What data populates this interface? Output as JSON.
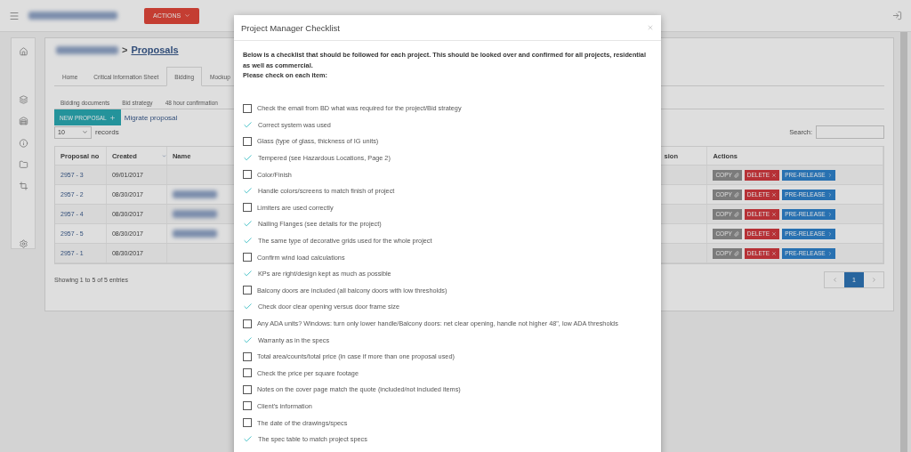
{
  "topbar": {
    "actions_button": "ACTIONS"
  },
  "breadcrumb": {
    "link": "Proposals",
    "separator": ">"
  },
  "tabs": [
    {
      "label": "Home",
      "selected": false
    },
    {
      "label": "Critical Information Sheet",
      "selected": false
    },
    {
      "label": "Bidding",
      "selected": true
    },
    {
      "label": "Mockup",
      "selected": false
    }
  ],
  "subtabs": [
    {
      "label": "Bidding documents",
      "selected": false
    },
    {
      "label": "Bid strategy",
      "selected": false
    },
    {
      "label": "48 hour confirmation",
      "selected": false
    }
  ],
  "toolbar": {
    "new_proposal": "NEW PROPOSAL",
    "migrate": "Migrate proposal",
    "page_size": "10",
    "records": "records",
    "search_label": "Search:"
  },
  "table": {
    "columns": [
      "Proposal no",
      "Created",
      "Name",
      "sion",
      "Actions"
    ],
    "rows": [
      {
        "proposal_no": "2957 - 3",
        "created": "09/01/2017",
        "has_name": false,
        "actions": [
          {
            "kind": "copy",
            "label": "COPY"
          },
          {
            "kind": "delete",
            "label": "DELETE"
          },
          {
            "kind": "release",
            "label": "PRE-RELEASE"
          }
        ]
      },
      {
        "proposal_no": "2957 - 2",
        "created": "08/30/2017",
        "has_name": true,
        "actions": [
          {
            "kind": "copy",
            "label": "COPY"
          },
          {
            "kind": "delete",
            "label": "DELETE"
          },
          {
            "kind": "release",
            "label": "PRE-RELEASE"
          }
        ]
      },
      {
        "proposal_no": "2957 - 4",
        "created": "08/30/2017",
        "has_name": true,
        "actions": [
          {
            "kind": "copy",
            "label": "COPY"
          },
          {
            "kind": "delete",
            "label": "DELETE"
          },
          {
            "kind": "release",
            "label": "PRE-RELEASE"
          }
        ]
      },
      {
        "proposal_no": "2957 - 5",
        "created": "08/30/2017",
        "has_name": true,
        "actions": [
          {
            "kind": "copy",
            "label": "COPY"
          },
          {
            "kind": "delete",
            "label": "DELETE"
          },
          {
            "kind": "release",
            "label": "PRE-RELEASE"
          }
        ]
      },
      {
        "proposal_no": "2957 - 1",
        "created": "08/30/2017",
        "has_name": false,
        "actions": [
          {
            "kind": "copy",
            "label": "COPY"
          },
          {
            "kind": "delete",
            "label": "DELETE"
          },
          {
            "kind": "release",
            "label": "PRE-RELEASE"
          }
        ]
      }
    ]
  },
  "footer": {
    "info": "Showing 1 to 5 of 5 entries",
    "pages": [
      {
        "label": "1",
        "selected": true
      }
    ]
  },
  "modal": {
    "title": "Project Manager Checklist",
    "intro": "Below is a checklist that should be followed for each project. This should be looked over and confirmed for all projects, residential as well as commercial.",
    "prompt": "Please check on each item:",
    "items": [
      {
        "label": "Check the email from BD what was required for the project/Bid strategy",
        "checked": false
      },
      {
        "label": "Correct system was used",
        "checked": true
      },
      {
        "label": "Glass (type of glass, thickness of IG units)",
        "checked": false
      },
      {
        "label": "Tempered (see Hazardous Locations, Page 2)",
        "checked": true
      },
      {
        "label": "Color/Finish",
        "checked": false
      },
      {
        "label": "Handle colors/screens to match finish of project",
        "checked": true
      },
      {
        "label": "Limiters are used correctly",
        "checked": false
      },
      {
        "label": "Nailing Flanges (see details for the project)",
        "checked": true
      },
      {
        "label": "The same type of decorative grids used for the whole project",
        "checked": true
      },
      {
        "label": "Confirm wind load calculations",
        "checked": false
      },
      {
        "label": "KPs are right/design kept as much as possible",
        "checked": true
      },
      {
        "label": "Balcony doors are included (all balcony doors with low thresholds)",
        "checked": false
      },
      {
        "label": "Check door clear opening versus door frame size",
        "checked": true
      },
      {
        "label": "Any ADA units? Windows: turn only lower handle/Balcony doors: net clear opening, handle not higher 48\", low ADA thresholds",
        "checked": false
      },
      {
        "label": "Warranty as in the specs",
        "checked": true
      },
      {
        "label": "Total area/counts/total price (in case if more than one proposal used)",
        "checked": false
      },
      {
        "label": "Check the price per square footage",
        "checked": false
      },
      {
        "label": "Notes on the cover page match the quote (included/not included items)",
        "checked": false
      },
      {
        "label": "Client's information",
        "checked": false
      },
      {
        "label": "The date of the drawings/specs",
        "checked": false
      },
      {
        "label": "The spec table to match project specs",
        "checked": true
      }
    ]
  }
}
